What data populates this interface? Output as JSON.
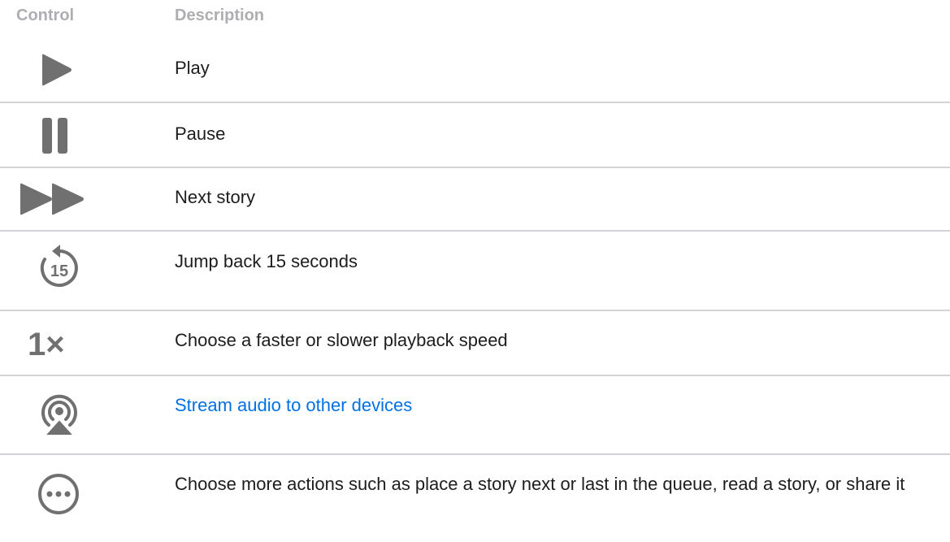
{
  "table": {
    "headers": {
      "control": "Control",
      "description": "Description"
    },
    "rows": [
      {
        "icon": "play-icon",
        "description": "Play",
        "is_link": false
      },
      {
        "icon": "pause-icon",
        "description": "Pause",
        "is_link": false
      },
      {
        "icon": "next-story-icon",
        "description": "Next story",
        "is_link": false
      },
      {
        "icon": "skip-back-15-icon",
        "icon_text": "15",
        "description": "Jump back 15 seconds",
        "is_link": false
      },
      {
        "icon": "playback-speed-icon",
        "icon_text": "1×",
        "description": "Choose a faster or slower playback speed",
        "is_link": false
      },
      {
        "icon": "airplay-icon",
        "description": "Stream audio to other devices",
        "is_link": true
      },
      {
        "icon": "more-icon",
        "description": "Choose more actions such as place a story next or last in the queue, read a story, or share it",
        "is_link": false
      }
    ]
  },
  "colors": {
    "icon_gray": "#707070",
    "header_gray": "#aeaeb2",
    "divider": "#d2d2d7",
    "link_blue": "#0071e3",
    "text": "#1d1d1f"
  }
}
